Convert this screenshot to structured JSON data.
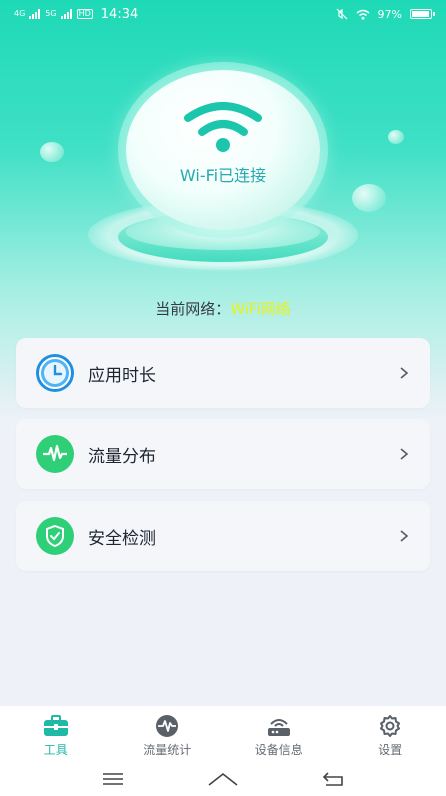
{
  "status_bar": {
    "network_1": "4G",
    "network_2": "5G",
    "network_3": "HD",
    "time": "14:34",
    "battery": "97%",
    "battery_level": 0.97
  },
  "hero": {
    "status_label": "Wi-Fi已连接"
  },
  "network": {
    "prefix": "当前网络：",
    "value": "WiFi网络"
  },
  "menu": [
    {
      "label": "应用时长",
      "icon": "clock-icon"
    },
    {
      "label": "流量分布",
      "icon": "pulse-icon"
    },
    {
      "label": "安全检测",
      "icon": "shield-icon"
    }
  ],
  "tabs": [
    {
      "label": "工具",
      "icon": "toolbox-icon",
      "active": true
    },
    {
      "label": "流量统计",
      "icon": "pulse-icon",
      "active": false
    },
    {
      "label": "设备信息",
      "icon": "router-icon",
      "active": false
    },
    {
      "label": "设置",
      "icon": "gear-icon",
      "active": false
    }
  ],
  "colors": {
    "accent": "#1fb9a6",
    "network_value": "#e8f21a",
    "header_top": "#1ed9b6"
  }
}
